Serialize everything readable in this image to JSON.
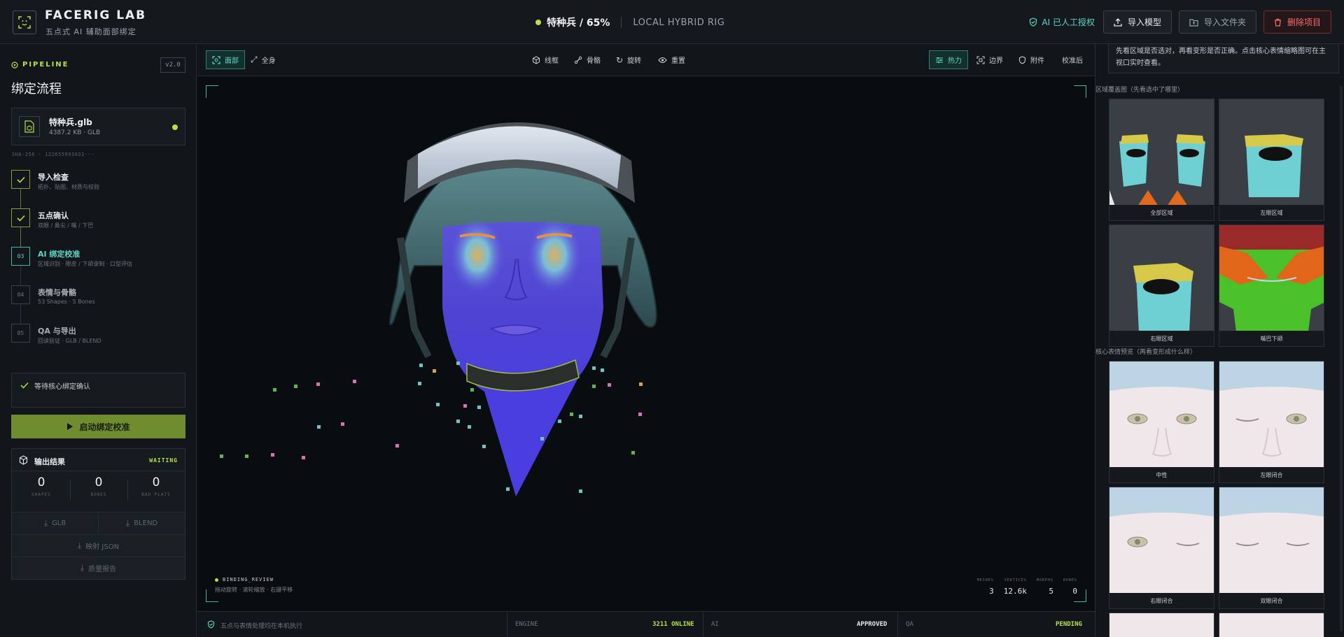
{
  "header": {
    "brand": "FACERIG LAB",
    "subtitle": "五点式 AI 辅助面部绑定",
    "model_status": "特种兵 / 65%",
    "engine_label": "LOCAL HYBRID RIG",
    "ai_auth": "AI 已人工授权",
    "import_model": "导入模型",
    "import_folder": "导入文件夹",
    "delete_project": "删除项目"
  },
  "sidebar": {
    "pipeline_label": "PIPELINE",
    "version": "v2.0",
    "flow_title": "绑定流程",
    "file": {
      "name": "特种兵.glb",
      "meta": "4387.2 KB · GLB"
    },
    "sha": "SHA-256 · 122655993031···",
    "steps": [
      {
        "num": "✓",
        "title": "导入检查",
        "sub": "拓扑、贴图、材质与校验",
        "state": "done"
      },
      {
        "num": "✓",
        "title": "五点确认",
        "sub": "双眼 / 鼻尖 / 嘴 / 下巴",
        "state": "done"
      },
      {
        "num": "03",
        "title": "AI 绑定校准",
        "sub": "区域识别 · 眼皮 / 下颌录制 · 口型评估",
        "state": "active"
      },
      {
        "num": "04",
        "title": "表情与骨骼",
        "sub": "53 Shapes · 5 Bones",
        "state": "pending"
      },
      {
        "num": "05",
        "title": "QA 与导出",
        "sub": "回读验证 · GLB / BLEND",
        "state": "pending"
      }
    ],
    "wait_text": "等待核心绑定确认",
    "start_button": "启动绑定校准",
    "output": {
      "title": "输出结果",
      "status": "WAITING",
      "stats": [
        {
          "value": "0",
          "label": "SHAPES"
        },
        {
          "value": "0",
          "label": "BONES"
        },
        {
          "value": "0",
          "label": "BAD PLATS"
        }
      ],
      "glb": "GLB",
      "blend": "BLEND",
      "json": "映射 JSON",
      "report": "质量报告"
    }
  },
  "toolbar": {
    "face": "面部",
    "full": "全身",
    "wire": "线框",
    "bones": "骨骼",
    "rotate": "旋转",
    "reset": "重置",
    "heat": "热力",
    "boundary": "边界",
    "attach": "附件",
    "calibrated": "校准后"
  },
  "viewport": {
    "status": "BINDING_REVIEW",
    "hint": "拖动旋转 · 滚轮缩放 · 右键平移",
    "metrics": [
      {
        "label": "MESHES",
        "value": "3"
      },
      {
        "label": "VERTICES",
        "value": "12.6k"
      },
      {
        "label": "MORPHS",
        "value": "5"
      },
      {
        "label": "BONES",
        "value": "0"
      }
    ]
  },
  "statusbar": {
    "local_note": "五点与表情处理均在本机执行",
    "engine_label": "ENGINE",
    "engine_value": "3211 ONLINE",
    "ai_label": "AI",
    "ai_value": "APPROVED",
    "qa_label": "QA",
    "qa_value": "PENDING"
  },
  "right_panel": {
    "note": "先看区域是否选对，再看变形是否正确。点击核心表情缩略图可在主视口实时查看。",
    "region_title": "区域覆盖图（先看选中了哪里）",
    "regions": [
      "全部区域",
      "左眼区域",
      "右眼区域",
      "嘴巴下颌"
    ],
    "expr_title": "核心表情预览（再看变形成什么样）",
    "expressions": [
      "中性",
      "左眼闭合",
      "右眼闭合",
      "双眼闭合"
    ]
  },
  "colors": {
    "accent_lime": "#b8e04a",
    "accent_teal": "#5ad8c6",
    "danger": "#ff6b6b",
    "start_button": "#6f8d2f"
  }
}
